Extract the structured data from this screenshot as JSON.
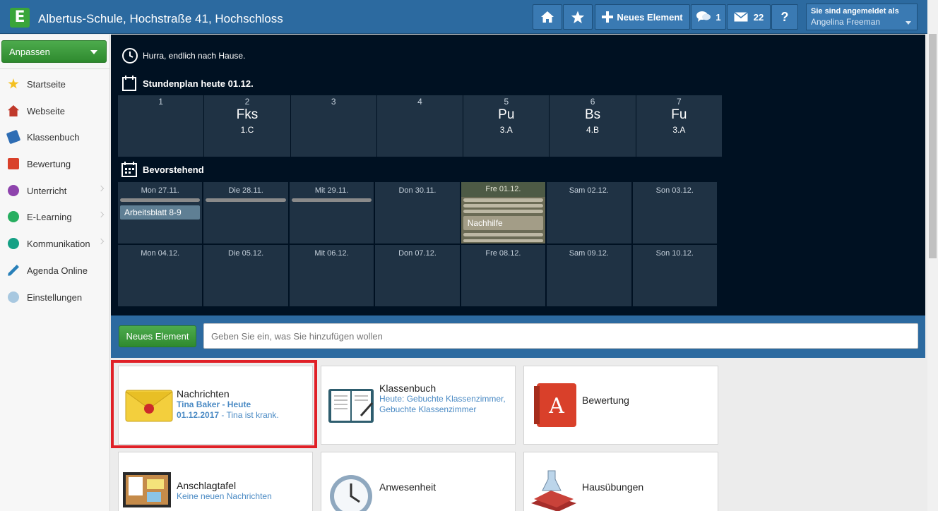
{
  "header": {
    "logo_letter": "E",
    "school": "Albertus-Schule, Hochstraße 41, Hochschloss",
    "new_element_label": "Neues Element",
    "chat_count": "1",
    "mail_count": "22",
    "help_label": "?",
    "login_label": "Sie sind angemeldet als",
    "user_name": "Angelina Freeman"
  },
  "sidebar": {
    "customize_label": "Anpassen",
    "items": [
      {
        "label": "Startseite",
        "icon": "star-icon",
        "color": "#f4c020"
      },
      {
        "label": "Webseite",
        "icon": "house-icon",
        "color": "#c0392b"
      },
      {
        "label": "Klassenbuch",
        "icon": "book-icon",
        "color": "#2e6db4"
      },
      {
        "label": "Bewertung",
        "icon": "grade-icon",
        "color": "#d9402a"
      },
      {
        "label": "Unterricht",
        "icon": "teaching-icon",
        "color": "#8e44ad"
      },
      {
        "label": "E-Learning",
        "icon": "globe-icon",
        "color": "#27ae60"
      },
      {
        "label": "Kommunikation",
        "icon": "communication-icon",
        "color": "#16a085"
      },
      {
        "label": "Agenda Online",
        "icon": "pen-icon",
        "color": "#2980b9"
      },
      {
        "label": "Einstellungen",
        "icon": "settings-icon",
        "color": "#a8c8e0"
      }
    ]
  },
  "dashboard": {
    "motto": "Hurra, endlich nach Hause.",
    "timetable_title": "Stundenplan heute 01.12.",
    "timetable": [
      {
        "period": "1",
        "subject": "",
        "class": ""
      },
      {
        "period": "2",
        "subject": "Fks",
        "class": "1.C"
      },
      {
        "period": "3",
        "subject": "",
        "class": ""
      },
      {
        "period": "4",
        "subject": "",
        "class": ""
      },
      {
        "period": "5",
        "subject": "Pu",
        "class": "3.A"
      },
      {
        "period": "6",
        "subject": "Bs",
        "class": "4.B"
      },
      {
        "period": "7",
        "subject": "Fu",
        "class": "3.A"
      }
    ],
    "upcoming_title": "Bevorstehend",
    "week1": [
      "Mon 27.11.",
      "Die 28.11.",
      "Mit 29.11.",
      "Don 30.11.",
      "Fre 01.12.",
      "Sam 02.12.",
      "Son 03.12."
    ],
    "week2": [
      "Mon 04.12.",
      "Die 05.12.",
      "Mit 06.12.",
      "Don 07.12.",
      "Fre 08.12.",
      "Sam 09.12.",
      "Son 10.12."
    ],
    "events": {
      "worksheet": "Arbeitsblatt 8-9",
      "tutoring": "Nachhilfe"
    }
  },
  "quickadd": {
    "button_label": "Neues Element",
    "placeholder": "Geben Sie ein, was Sie hinzufügen wollen"
  },
  "tiles": {
    "messages": {
      "title": "Nachrichten",
      "line1": "Tina Baker - Heute",
      "line2_date": "01.12.2017",
      "line2_text": " - Tina ist krank."
    },
    "classbook": {
      "title": "Klassenbuch",
      "text": "Heute: Gebuchte Klassenzimmer, Gebuchte Klassenzimmer"
    },
    "grading": {
      "title": "Bewertung"
    },
    "board": {
      "title": "Anschlagtafel",
      "text": "Keine neuen Nachrichten"
    },
    "attendance": {
      "title": "Anwesenheit"
    },
    "homework": {
      "title": "Hausübungen"
    }
  }
}
